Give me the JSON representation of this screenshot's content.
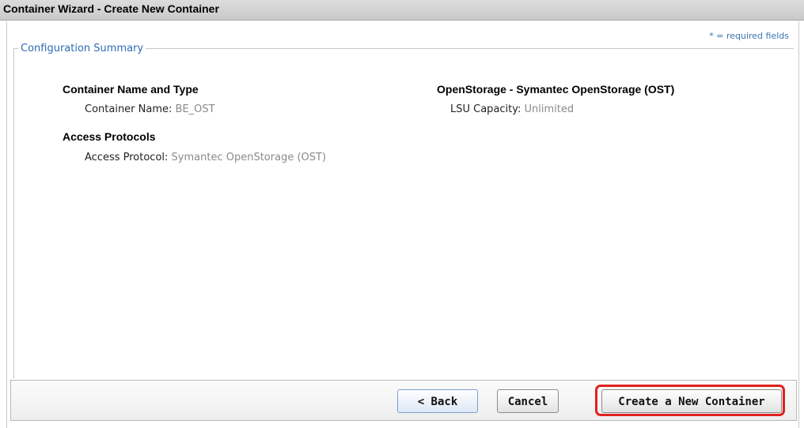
{
  "window": {
    "title": "Container Wizard - Create New Container"
  },
  "required_note": "* = required fields",
  "fieldset": {
    "legend": "Configuration Summary"
  },
  "sections": {
    "container": {
      "title": "Container Name and Type",
      "name_label": "Container Name:",
      "name_value": "BE_OST"
    },
    "access": {
      "title": "Access Protocols",
      "protocol_label": "Access Protocol:",
      "protocol_value": "Symantec OpenStorage (OST)"
    },
    "openstorage": {
      "title": "OpenStorage - Symantec OpenStorage (OST)",
      "lsu_label": "LSU Capacity:",
      "lsu_value": "Unlimited"
    }
  },
  "buttons": {
    "back": "< Back",
    "cancel": "Cancel",
    "create": "Create a New Container"
  },
  "colors": {
    "legend": "#2f6db4",
    "value_text": "#8a8a8a",
    "highlight": "#e0221d"
  }
}
